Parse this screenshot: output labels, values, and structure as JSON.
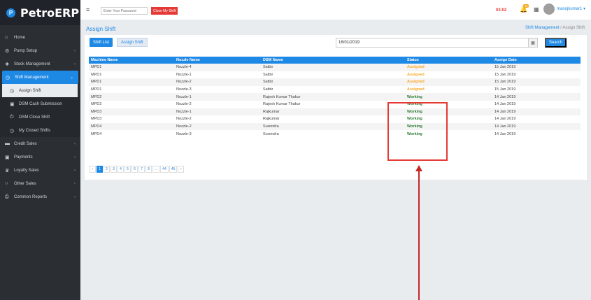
{
  "app": {
    "name": "PetroERP",
    "logo_glyph": "P"
  },
  "sidebar": {
    "items": [
      {
        "label": "Home",
        "icon": "home-icon",
        "glyph": "⌂",
        "chevron": ""
      },
      {
        "label": "Pump Setup",
        "icon": "cogs-icon",
        "glyph": "⚙",
        "chevron": "‹"
      },
      {
        "label": "Stock Management",
        "icon": "cubes-icon",
        "glyph": "❖",
        "chevron": "‹"
      },
      {
        "label": "Shift Management",
        "icon": "clock-icon",
        "glyph": "◷",
        "chevron": "⌄"
      },
      {
        "label": "Assign Shift",
        "icon": "clock-icon",
        "glyph": "◷",
        "chevron": ""
      },
      {
        "label": "DSM Cash Submission",
        "icon": "money-icon",
        "glyph": "▣",
        "chevron": ""
      },
      {
        "label": "DSM Close Shift",
        "icon": "power-icon",
        "glyph": "⏻",
        "chevron": ""
      },
      {
        "label": "My Closed Shifts",
        "icon": "clock-icon",
        "glyph": "◷",
        "chevron": ""
      },
      {
        "label": "Credit Sales",
        "icon": "credit-card-icon",
        "glyph": "▬",
        "chevron": "‹"
      },
      {
        "label": "Payments",
        "icon": "money-icon",
        "glyph": "▣",
        "chevron": "‹"
      },
      {
        "label": "Loyalty Sales",
        "icon": "trophy-icon",
        "glyph": "♛",
        "chevron": "‹"
      },
      {
        "label": "Other Sales",
        "icon": "circle-icon",
        "glyph": "○",
        "chevron": "‹"
      },
      {
        "label": "Common Reports",
        "icon": "print-icon",
        "glyph": "⎙",
        "chevron": "‹"
      }
    ]
  },
  "topbar": {
    "menu_glyph": "≡",
    "password_placeholder": "Enter Your Password",
    "close_shift_label": "Close My Shift",
    "timer": "03:02",
    "bell_glyph": "🔔",
    "notif_count": "99",
    "apps_glyph": "▦",
    "user": "manojkumar1 ▾"
  },
  "page": {
    "title": "Assign Shift",
    "breadcrumb_parent": "Shift Management",
    "breadcrumb_sep": " / ",
    "breadcrumb_current": "Assign Shift"
  },
  "tabs": {
    "shift_list": "Shift List",
    "assign_shift": "Assign Shift"
  },
  "filter": {
    "date": "16/01/2019",
    "calendar_glyph": "▦",
    "search_label": "Search"
  },
  "table": {
    "headers": [
      "Machine Name",
      "Nozzle Name",
      "DSM Name",
      "Status",
      "Assign Date"
    ],
    "rows": [
      [
        "MPD1",
        "Nozzle-4",
        "Satbir",
        "Assigned",
        "15 Jan 2019"
      ],
      [
        "MPD1",
        "Nozzle-1",
        "Satbir",
        "Assigned",
        "15 Jan 2019"
      ],
      [
        "MPD1",
        "Nozzle-2",
        "Satbir",
        "Assigned",
        "15 Jan 2019"
      ],
      [
        "MPD1",
        "Nozzle-3",
        "Satbir",
        "Assigned",
        "15 Jan 2019"
      ],
      [
        "MPD2",
        "Nozzle-1",
        "Rajesh Kumar Thakur",
        "Working",
        "14 Jan 2019"
      ],
      [
        "MPD2",
        "Nozzle-2",
        "Rajesh Kumar Thakur",
        "Working",
        "14 Jan 2019"
      ],
      [
        "MPD3",
        "Nozzle-1",
        "Rajkumar",
        "Working",
        "14 Jan 2019"
      ],
      [
        "MPD3",
        "Nozzle-2",
        "Rajkumar",
        "Working",
        "14 Jan 2019"
      ],
      [
        "MPD4",
        "Nozzle-2",
        "Surendra",
        "Working",
        "14 Jan 2019"
      ],
      [
        "MPD4",
        "Nozzle-3",
        "Surendra",
        "Working",
        "14 Jan 2019"
      ]
    ]
  },
  "pagination": [
    "‹",
    "1",
    "2",
    "3",
    "4",
    "5",
    "6",
    "7",
    "8",
    "...",
    "44",
    "45",
    "›"
  ],
  "colors": {
    "accent": "#1e88e5",
    "sidebar": "#2b2f33",
    "assigned": "#f9a825",
    "working": "#2e7d32",
    "highlight": "#e53935"
  }
}
